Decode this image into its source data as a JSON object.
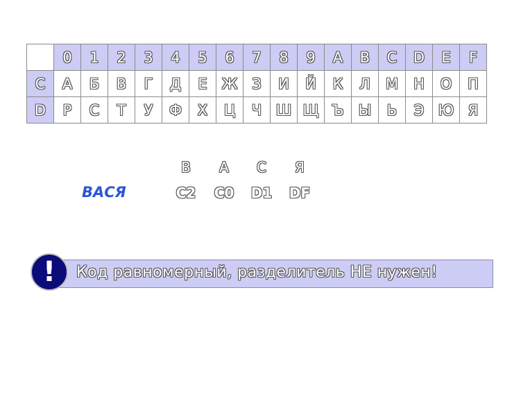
{
  "table": {
    "header": [
      "0",
      "1",
      "2",
      "3",
      "4",
      "5",
      "6",
      "7",
      "8",
      "9",
      "A",
      "B",
      "C",
      "D",
      "E",
      "F"
    ],
    "rows": [
      {
        "label": "C",
        "cells": [
          "А",
          "Б",
          "В",
          "Г",
          "Д",
          "Е",
          "Ж",
          "З",
          "И",
          "Й",
          "К",
          "Л",
          "М",
          "Н",
          "О",
          "П"
        ]
      },
      {
        "label": "D",
        "cells": [
          "Р",
          "С",
          "Т",
          "У",
          "Ф",
          "Х",
          "Ц",
          "Ч",
          "Ш",
          "Щ",
          "Ъ",
          "Ы",
          "Ь",
          "Э",
          "Ю",
          "Я"
        ]
      }
    ]
  },
  "example": {
    "word": "ВАСЯ",
    "letters": [
      "В",
      "А",
      "С",
      "Я"
    ],
    "codes": [
      "C2",
      "C0",
      "D1",
      "DF"
    ]
  },
  "note": {
    "icon": "exclamation-icon",
    "symbol": "!",
    "text": "Код равномерный, разделитель НЕ нужен!"
  },
  "colors": {
    "header_bg": "#ccccf5",
    "word_color": "#2b57d6",
    "icon_bg": "#0b0b7a"
  }
}
